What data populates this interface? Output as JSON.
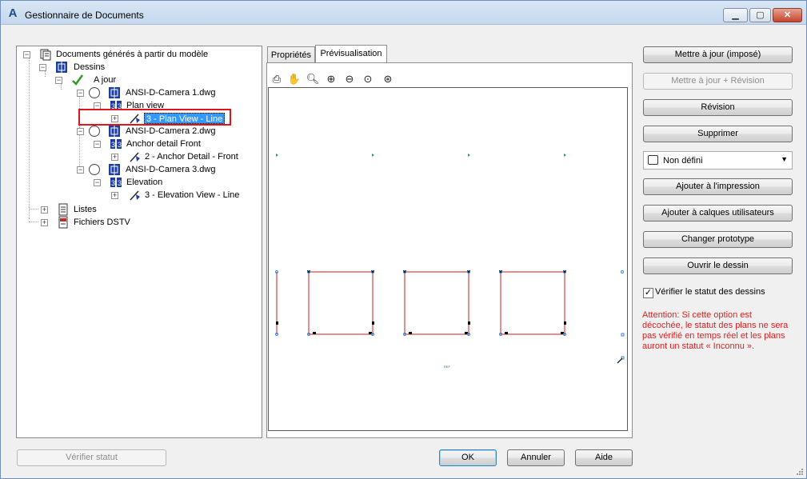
{
  "window": {
    "title": "Gestionnaire de Documents"
  },
  "tree": {
    "root": "Documents générés à partir du modèle",
    "dessins": "Dessins",
    "a_jour": "A jour",
    "items": [
      {
        "file": "ANSI-D-Camera 1.dwg",
        "view": "Plan view",
        "sheet": "3 - Plan View - Line"
      },
      {
        "file": "ANSI-D-Camera 2.dwg",
        "view": "Anchor detail Front",
        "sheet": "2 - Anchor Detail - Front"
      },
      {
        "file": "ANSI-D-Camera 3.dwg",
        "view": "Elevation",
        "sheet": "3 - Elevation View - Line"
      }
    ],
    "listes": "Listes",
    "fichiers_dstv": "Fichiers DSTV"
  },
  "tabs": [
    "Propriétés",
    "Prévisualisation"
  ],
  "active_tab": "Prévisualisation",
  "preview": {
    "tiny_label": "REF"
  },
  "buttons": {
    "mettre_a_jour_impose": "Mettre à jour (imposé)",
    "mettre_a_jour_revision": "Mettre à jour + Révision",
    "revision": "Révision",
    "supprimer": "Supprimer",
    "ajouter_impression": "Ajouter à l'impression",
    "ajouter_calques": "Ajouter à calques utilisateurs",
    "changer_prototype": "Changer prototype",
    "ouvrir_dessin": "Ouvrir le dessin",
    "verifier_statut": "Vérifier statut",
    "ok": "OK",
    "annuler": "Annuler",
    "aide": "Aide"
  },
  "dropdown": {
    "selected": "Non défini"
  },
  "checkbox": {
    "label": "Vérifier le statut des dessins",
    "checked": true
  },
  "warning": "Attention: Si cette option est décochée, le statut des plans ne sera pas vérifié en temps réel et les plans auront un statut « Inconnu ».",
  "colors": {
    "highlight": "#3399ff",
    "red_box": "#e0141e",
    "warning": "#e21d1d",
    "drawing_line": "#cc1e1e"
  }
}
